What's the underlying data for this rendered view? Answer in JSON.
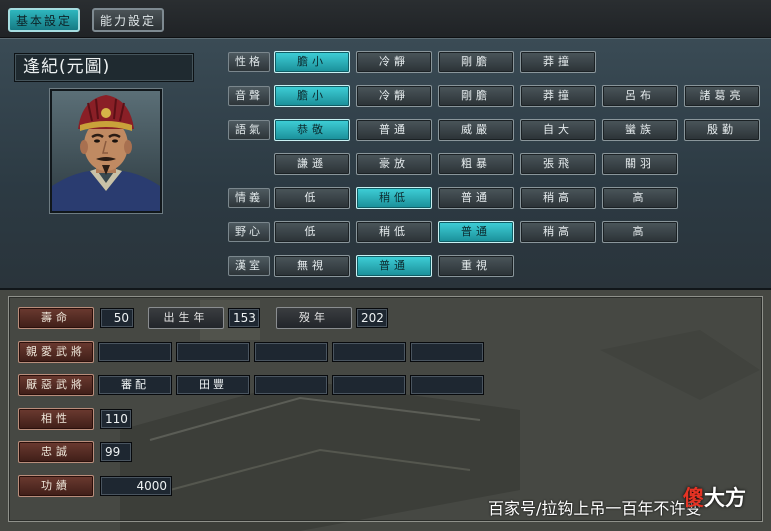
{
  "tabs": [
    {
      "label": "基本設定",
      "active": true
    },
    {
      "label": "能力設定",
      "active": false
    }
  ],
  "officer": {
    "name": "逢紀(元圖)"
  },
  "traits": [
    {
      "label": "性格",
      "options": [
        {
          "label": "膽小",
          "on": true
        },
        {
          "label": "冷靜",
          "on": false
        },
        {
          "label": "剛膽",
          "on": false
        },
        {
          "label": "莽撞",
          "on": false
        }
      ]
    },
    {
      "label": "音聲",
      "options": [
        {
          "label": "膽小",
          "on": true
        },
        {
          "label": "冷靜",
          "on": false
        },
        {
          "label": "剛膽",
          "on": false
        },
        {
          "label": "莽撞",
          "on": false
        },
        {
          "label": "呂布",
          "on": false
        },
        {
          "label": "諸葛亮",
          "on": false
        }
      ]
    },
    {
      "label": "語氣",
      "options": [
        {
          "label": "恭敬",
          "on": true
        },
        {
          "label": "普通",
          "on": false
        },
        {
          "label": "威嚴",
          "on": false
        },
        {
          "label": "自大",
          "on": false
        },
        {
          "label": "蠻族",
          "on": false
        },
        {
          "label": "殷勤",
          "on": false
        },
        {
          "label": "謙遜",
          "on": false
        },
        {
          "label": "豪放",
          "on": false
        },
        {
          "label": "粗暴",
          "on": false
        },
        {
          "label": "張飛",
          "on": false
        },
        {
          "label": "關羽",
          "on": false
        }
      ]
    },
    {
      "label": "情義",
      "options": [
        {
          "label": "低",
          "on": false
        },
        {
          "label": "稍低",
          "on": true
        },
        {
          "label": "普通",
          "on": false
        },
        {
          "label": "稍高",
          "on": false
        },
        {
          "label": "高",
          "on": false
        }
      ]
    },
    {
      "label": "野心",
      "options": [
        {
          "label": "低",
          "on": false
        },
        {
          "label": "稍低",
          "on": false
        },
        {
          "label": "普通",
          "on": true
        },
        {
          "label": "稍高",
          "on": false
        },
        {
          "label": "高",
          "on": false
        }
      ]
    },
    {
      "label": "漢室",
      "options": [
        {
          "label": "無視",
          "on": false
        },
        {
          "label": "普通",
          "on": true
        },
        {
          "label": "重視",
          "on": false
        }
      ]
    }
  ],
  "stats": {
    "lifespan": {
      "label": "壽命",
      "value": "50"
    },
    "birth": {
      "label": "出生年",
      "value": "153"
    },
    "death": {
      "label": "歿年",
      "value": "202"
    },
    "liked": {
      "label": "親愛武將",
      "values": [
        "",
        "",
        "",
        "",
        ""
      ]
    },
    "disliked": {
      "label": "厭惡武將",
      "values": [
        "審配",
        "田豐",
        "",
        "",
        ""
      ]
    },
    "compat": {
      "label": "相性",
      "value": "110"
    },
    "loyalty": {
      "label": "忠誠",
      "value": "99"
    },
    "merit": {
      "label": "功績",
      "value": "4000"
    }
  },
  "watermark": {
    "text": "百家号/拉钩上吊一百年不许变",
    "logo_a": "傻",
    "logo_b": "大方"
  },
  "colors": {
    "selected": "#2fb6be",
    "stat_label": "#6b3a30"
  }
}
